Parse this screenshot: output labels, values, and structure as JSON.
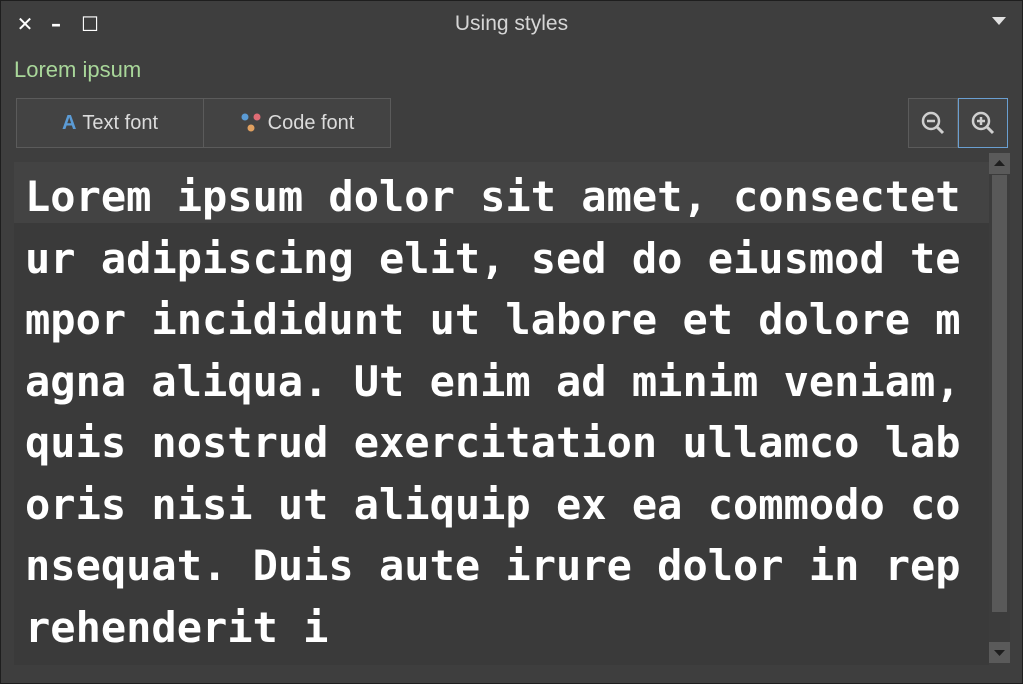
{
  "window": {
    "title": "Using styles",
    "close_glyph": "✕",
    "minimize_glyph": "–",
    "maximize_glyph": "☐"
  },
  "heading": "Lorem ipsum",
  "toolbar": {
    "text_font_label": "Text font",
    "code_font_label": "Code font",
    "zoom_out_icon": "zoom-out-icon",
    "zoom_in_icon": "zoom-in-icon"
  },
  "editor": {
    "content": "Lorem ipsum dolor sit amet, consectetur adipiscing elit, sed do eiusmod tempor incididunt ut labore et dolore magna aliqua. Ut enim ad minim veniam, quis nostrud exercitation ullamco laboris nisi ut aliquip ex ea commodo consequat. Duis aute irure dolor in reprehenderit i"
  },
  "colors": {
    "heading": "#a9d79a",
    "accent": "#6a9fd1",
    "text_font_icon": "#5b9bd5"
  }
}
